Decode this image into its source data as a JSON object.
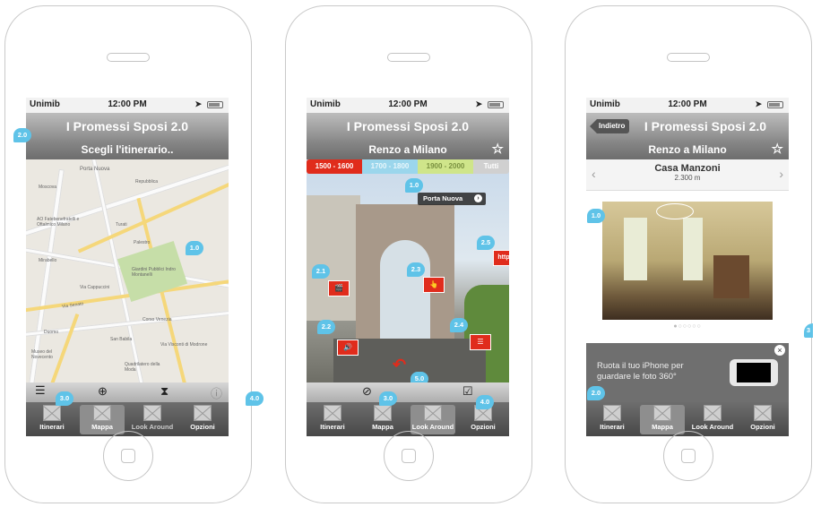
{
  "status": {
    "carrier": "Unimib",
    "time": "12:00 PM"
  },
  "app_title": "I Promessi Sposi 2.0",
  "colors": {
    "badge": "#5fc3e8",
    "period_active": "#e02c1c",
    "period_2": "#9bd6ec",
    "period_3": "#cfe58a",
    "hotspot": "#e02c1c"
  },
  "screen1": {
    "subtitle": "Scegli l'itinerario..",
    "map_labels": [
      "Porta Nuova",
      "Repubblica",
      "Moscova",
      "AO Fatebenefratelli e Oftalmico Milano",
      "Turati",
      "Palestro",
      "Giardini Pubblici Indro Montanelli",
      "Mirabello",
      "Via Senato",
      "Via Cappuccini",
      "Duomo",
      "Corso Venezia",
      "San Babila",
      "Museo del Novecento",
      "Via Visconti di Modrone",
      "Quadrilatero della Moda"
    ],
    "badges": [
      "2.0",
      "1.0",
      "3.0",
      "4.0"
    ],
    "toolbar_icons": [
      "list-icon",
      "locate-icon",
      "hourglass-icon",
      "info-icon"
    ]
  },
  "screen2": {
    "subtitle": "Renzo a Milano",
    "periods": [
      "1500 - 1600",
      "1700 - 1800",
      "1900 - 2000",
      "Tutti"
    ],
    "poi_label": "Porta Nuova",
    "hotspots": [
      {
        "badge": "2.1",
        "icon": "film-icon",
        "glyph": "🎬"
      },
      {
        "badge": "2.3",
        "icon": "hand-icon",
        "glyph": "👆"
      },
      {
        "badge": "2.5",
        "icon": "link-icon",
        "glyph": "http"
      },
      {
        "badge": "2.2",
        "icon": "speaker-icon",
        "glyph": "🔊"
      },
      {
        "badge": "2.4",
        "icon": "document-icon",
        "glyph": "☰"
      }
    ],
    "badges": [
      "1.0",
      "5.0",
      "3.0",
      "4.0"
    ],
    "toolbar_icons": [
      "compass-icon",
      "checkbox-icon"
    ]
  },
  "screen3": {
    "back_label": "Indietro",
    "subtitle": "Renzo a Milano",
    "place_title": "Casa Manzoni",
    "place_distance": "2.300 m",
    "page_dots": "●○○○○○",
    "rotate_text": "Ruota il tuo iPhone per guardare le foto 360°",
    "badges": [
      "1.0",
      "2.0",
      "3"
    ]
  },
  "tabs": [
    "Itinerari",
    "Mappa",
    "Look Around",
    "Opzioni"
  ]
}
